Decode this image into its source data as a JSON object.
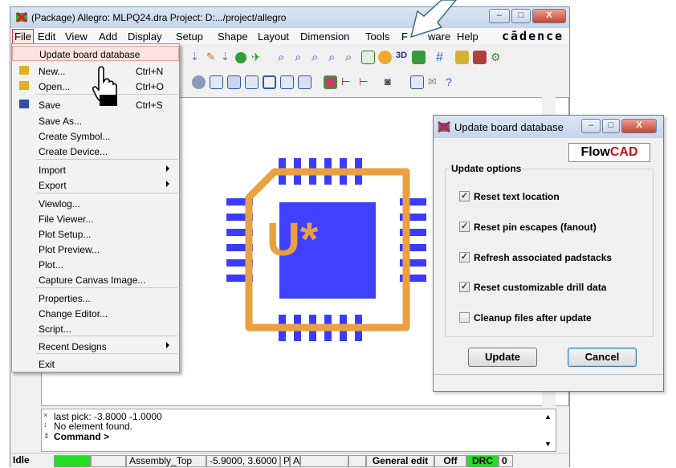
{
  "window": {
    "title": "(Package) Allegro: MLPQ24.dra  Project: D:.../project/allegro",
    "brand": "cādence",
    "caption_buttons": [
      "–",
      "□",
      "X"
    ]
  },
  "menubar": {
    "items": [
      "File",
      "Edit",
      "View",
      "Add",
      "Display",
      "Setup",
      "Shape",
      "Layout",
      "Dimension",
      "Tools",
      "F",
      "ware",
      "Help"
    ]
  },
  "file_menu": {
    "items": [
      {
        "label": "Update board database",
        "shortcut": ""
      },
      {
        "label": "New...",
        "shortcut": "Ctrl+N"
      },
      {
        "label": "Open...",
        "shortcut": "Ctrl+O"
      },
      {
        "label": "Save",
        "shortcut": "Ctrl+S"
      },
      {
        "label": "Save As...",
        "shortcut": ""
      },
      {
        "label": "Create Symbol...",
        "shortcut": ""
      },
      {
        "label": "Create Device...",
        "shortcut": ""
      },
      {
        "label": "Import",
        "shortcut": ""
      },
      {
        "label": "Export",
        "shortcut": ""
      },
      {
        "label": "Viewlog...",
        "shortcut": ""
      },
      {
        "label": "File Viewer...",
        "shortcut": ""
      },
      {
        "label": "Plot Setup...",
        "shortcut": ""
      },
      {
        "label": "Plot Preview...",
        "shortcut": ""
      },
      {
        "label": "Plot...",
        "shortcut": ""
      },
      {
        "label": "Capture Canvas Image...",
        "shortcut": ""
      },
      {
        "label": "Properties...",
        "shortcut": ""
      },
      {
        "label": "Change Editor...",
        "shortcut": ""
      },
      {
        "label": "Script...",
        "shortcut": ""
      },
      {
        "label": "Recent Designs",
        "shortcut": ""
      },
      {
        "label": "Exit",
        "shortcut": ""
      }
    ]
  },
  "canvas": {
    "part_label": "U*",
    "colors": {
      "pads": "#3b3bff",
      "outline": "#e8a040",
      "body": "#4040ff",
      "refdes": "#e8a040"
    }
  },
  "console": {
    "lines": [
      "last pick:  -3.8000  -1.0000",
      "No element found.",
      "Command >"
    ]
  },
  "statusbar": {
    "state": "Idle",
    "layer": "Assembly_Top",
    "coords": "-5.9000, 3.6000",
    "p": "P",
    "a": "A",
    "mode": "General edit",
    "off": "Off",
    "drc": "DRC",
    "drc_count": "0",
    "colors": {
      "idle_indicator": "#22dd22",
      "drc": "#22dd22"
    }
  },
  "dialog": {
    "title": "Update board database",
    "logo": {
      "flow": "Flow",
      "cad": "CAD",
      "cad_color": "#cc1111"
    },
    "group_title": "Update options",
    "options": [
      {
        "label": "Reset text location",
        "checked": true
      },
      {
        "label": "Reset pin escapes (fanout)",
        "checked": true
      },
      {
        "label": "Refresh associated padstacks",
        "checked": true
      },
      {
        "label": "Reset customizable drill data",
        "checked": true
      },
      {
        "label": "Cleanup files after update",
        "checked": false
      }
    ],
    "update_label": "Update",
    "cancel_label": "Cancel",
    "check_glyph": "✓"
  }
}
